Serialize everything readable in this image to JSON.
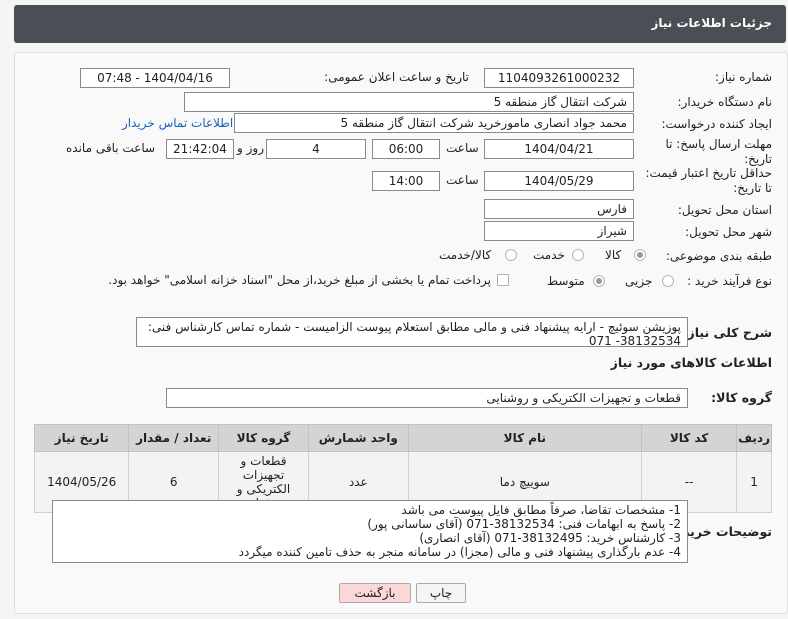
{
  "header": {
    "title": "جزئیات اطلاعات نیاز"
  },
  "fields": {
    "need_number_label": "شماره نیاز:",
    "need_number": "1104093261000232",
    "announce_label": "تاریخ و ساعت اعلان عمومی:",
    "announce_value": "1404/04/16 - 07:48",
    "buyer_org_label": "نام دستگاه خریدار:",
    "buyer_org": "شرکت انتقال گاز منطقه 5",
    "creator_label": "ایجاد کننده درخواست:",
    "creator": "محمد جواد انصاری مامورخرید شرکت انتقال گاز منطقه 5",
    "contact_link": "اطلاعات تماس خریدار",
    "deadline_label_1": "مهلت ارسال پاسخ: تا",
    "deadline_label_2": "تاریخ:",
    "deadline_date": "1404/04/21",
    "time_label": "ساعت",
    "deadline_time": "06:00",
    "days_value": "4",
    "days_label": "روز و",
    "remaining_time": "21:42:04",
    "remaining_label": "ساعت باقی مانده",
    "validity_label_1": "حداقل تاریخ اعتبار قیمت:",
    "validity_label_2": "تا تاریخ:",
    "validity_date": "1404/05/29",
    "validity_time": "14:00",
    "province_label": "استان محل تحویل:",
    "province": "فارس",
    "city_label": "شهر محل تحویل:",
    "city": "شیراز",
    "category_label": "طبقه بندی موضوعی:",
    "category_options": [
      "کالا",
      "خدمت",
      "کالا/خدمت"
    ],
    "category_selected": "کالا",
    "process_label": "نوع فرآیند خرید :",
    "process_options": [
      "جزیی",
      "متوسط"
    ],
    "process_selected": "متوسط",
    "payment_note": "پرداخت تمام یا بخشی از مبلغ خرید،از محل \"اسناد خزانه اسلامی\" خواهد بود."
  },
  "description": {
    "label": "شرح کلی نیاز:",
    "text": "پوزیشن سوئیچ - ارایه پیشنهاد فنی و مالی مطابق استعلام پیوست الزامیست - شماره تماس کارشناس فنی: 38132534- 071"
  },
  "goods": {
    "section_title": "اطلاعات کالاهای مورد نیاز",
    "group_label": "گروه کالا:",
    "group_value": "قطعات و تجهیزات الکتریکی و روشنایی",
    "columns": [
      "ردیف",
      "کد کالا",
      "نام کالا",
      "واحد شمارش",
      "گروه کالا",
      "تعداد / مقدار",
      "تاریخ نیاز"
    ],
    "rows": [
      {
        "row": "1",
        "code": "--",
        "name": "سوییچ دما",
        "unit": "عدد",
        "group": "قطعات و تجهیزات الکتریکی و روشنایی",
        "qty": "6",
        "date": "1404/05/26"
      }
    ]
  },
  "buyer_notes": {
    "label": "توضیحات خریدار:",
    "lines": [
      "1-  مشخصات تقاضا، صرفاً مطابق فایل پیوست می باشد",
      "2- پاسخ به ابهامات فنی: 38132534-071 (آقای ساسانی پور)",
      "3- کارشناس خرید: 38132495-071 (آقای انصاری)",
      "4- عدم بارگذاری پیشنهاد فنی و مالی (مجزا) در سامانه منجر به حذف تامین کننده میگردد"
    ]
  },
  "buttons": {
    "print": "چاپ",
    "back": "بازگشت"
  },
  "colors": {
    "header_bg": "#4a4f55",
    "link": "#1a63b8",
    "back_btn_bg": "#fbd7d7"
  }
}
